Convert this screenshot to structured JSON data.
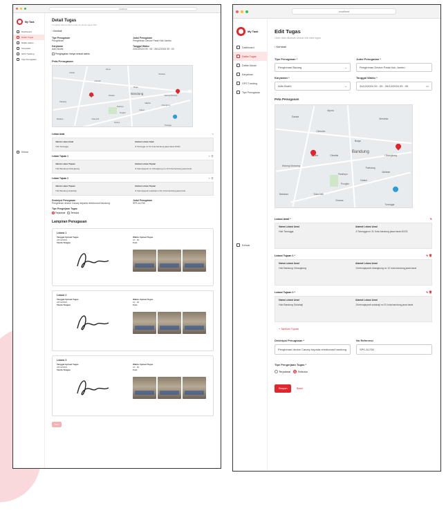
{
  "colors": {
    "brand": "#e0262d",
    "active_bg": "#fde4e5"
  },
  "left": {
    "url": "localhost",
    "brand": "My Task",
    "nav": [
      "Dashboard",
      "Daftar Tugas",
      "Daftar Aduan",
      "Karyawan",
      "GPS Tracking",
      "Tipe Penugasan"
    ],
    "logout": "Keluar",
    "title": "Detail Tugas",
    "subtitle": "Lengkapi data berikut untuk membuat tugas baru",
    "back": "Kembali",
    "fields": {
      "tipe_label": "Tipe Penugasan",
      "tipe_value": "Pengiriman",
      "judul_label": "Judul Penugasan",
      "judul_value": "Pengiriman Device Pada Hub Jambu",
      "karyawan_label": "Karyawan",
      "karyawan_value": "Adhi Budhi",
      "tanggal_label": "Tanggal Waktu",
      "tanggal_value": "24/12/2024 09 : 00 - 26/12/2024 09 : 00",
      "checkbox": "Pengingatan hanya sesuai waktu"
    },
    "map_title": "Peta Penugasan",
    "map_labels": [
      "Gasala",
      "Arjuna",
      "Merdeka",
      "Cimunim",
      "Braga",
      "Bandung",
      "Jamika",
      "Cibadak",
      "Warung Muncang",
      "Paledang",
      "Malabar",
      "Cibangkong",
      "Pasirluyu",
      "Ciateul",
      "Pungkur",
      "Babakan",
      "Suka Asih",
      "Cisarua",
      "Turangga"
    ],
    "lokasi_awal": "Lokasi Awal",
    "lokasi_tujuan1": "Lokasi Tujuan 1",
    "lokasi_tujuan2": "Lokasi Tujuan 2",
    "nama_awal_label": "Nama Lokasi Awal",
    "alamat_awal_label": "Alamat Lokasi Awal",
    "nama_tujuan_label": "Nama Lokasi Tujuan",
    "alamat_tujuan_label": "Alamat Lokasi Tujuan",
    "awal_nama": "Hub Tarungga",
    "awal_alamat": "Jl Tarungga no 31 Kota bandung jawa barat 40231",
    "t1_nama": "Hub Bandung Cibangkong",
    "t1_alamat": "Jl Kebonjayanti no Cibangkong no 12 Kota bandung jawa barat",
    "t2_nama": "Hub Bandung Sukahaji",
    "t2_alamat": "Jl Kebonjayanti sukahaji no 91 Kota bandung jawa barat",
    "desk_label": "Deskripsi Penugasan",
    "desk_value": "Pengiriman device Canary kepada reimbursed bandung",
    "ref_label": "Judul Penugasan",
    "ref_value": "SPK-A1750",
    "tipe_pgj_label": "Tipe Pengerjaan Tugas",
    "tipe_pgj_opt1": "Terjadwal",
    "tipe_pgj_opt2": "Terbuka",
    "lampiran_title": "Lampiran Penugasan",
    "lampiran": [
      {
        "title": "Lokasi 1",
        "tgl_label": "Tanggal Upload Tugas",
        "tgl": "24/12/2024",
        "waktu_label": "Waktu Upload Tugas",
        "waktu": "10 : 00",
        "ttd_label": "Tanda Tangan",
        "foto_label": "Foto"
      },
      {
        "title": "Lokasi 2",
        "tgl_label": "Tanggal Upload Tugas",
        "tgl": "24/12/2024",
        "waktu_label": "Waktu Upload Tugas",
        "waktu": "10 : 00",
        "ttd_label": "Tanda Tangan",
        "foto_label": "Foto"
      },
      {
        "title": "Lokasi 3",
        "tgl_label": "Tanggal Upload Tugas",
        "tgl": "24/12/2024",
        "waktu_label": "Waktu Upload Tugas",
        "waktu": "10 : 00",
        "ttd_label": "Tanda Tangan",
        "foto_label": "Foto"
      }
    ],
    "edit_button": "Edit"
  },
  "right": {
    "url": "localhost",
    "brand": "My Task",
    "nav": [
      "Dashboard",
      "Daftar Tugas",
      "Daftar Aduan",
      "Karyawan",
      "GPS Tracking",
      "Tipe Penugasan"
    ],
    "logout": "Keluar",
    "title": "Edit Tugas",
    "subtitle": "Ubah data dibawah sesuai edit data tugas",
    "back": "Kembali",
    "tipe_label": "Tipe Penugasan *",
    "tipe_value": "Pengiriman Barang",
    "judul_label": "Judul Penugasan *",
    "judul_value": "Pengiriman Device Pada Hub Jambu",
    "karyawan_label": "Karyawan *",
    "karyawan_value": "Adhi Budhi",
    "tanggal_label": "Tanggal Waktu *",
    "tanggal_value": "24/12/2024 09 : 00 - 26/12/2024 09 : 00",
    "map_title": "Peta Penugasan",
    "map_labels": [
      "Gasala",
      "Arjuna",
      "Merdeka",
      "Cimunim",
      "Braga",
      "Bandung",
      "Jamika",
      "Cibadak",
      "Cibangkong",
      "Warung Muncang",
      "Paledang",
      "Malabar",
      "Pasirluyu",
      "Ciateul",
      "Pungkur",
      "Babakan",
      "Suka Asih",
      "Cisarua",
      "Turangga"
    ],
    "lokasi_awal": "Lokasi Awal *",
    "lokasi_tujuan1": "Lokasi Tujuan 1 *",
    "lokasi_tujuan2": "Lokasi Tujuan 2 *",
    "nama_awal_label": "Nama Lokasi Awal",
    "alamat_awal_label": "Alamat Lokasi Awal",
    "nama_tujuan_label": "Nama Lokasi Awal",
    "alamat_tujuan_label": "Alamat Lokasi Awal",
    "awal_nama": "Hub Tarungga",
    "awal_alamat": "Jl Tarungga no 31 Kota bandung jawa barat 40231",
    "t1_nama": "Hub Bandung Cibangkong",
    "t1_alamat": "Jl kebonjayanti cibangkong no 12 kota bandung jawa barat",
    "t2_nama": "Hub Bandung Sukahaji",
    "t2_alamat": "Jl kebonjayanti sukahaji no 91 kota bandung jawa barat",
    "tambah": "+ Tambah Tujuan",
    "desk_label": "Deskripsi Penugasan *",
    "desk_value": "Pengiriman device Canary kepada reimbursed bandung",
    "ref_label": "No Referensi",
    "ref_value": "SPK-A1750",
    "tipe_pgj_label": "Tipe Pengerjaan Tugas *",
    "tipe_pgj_opt1": "Terjadwal",
    "tipe_pgj_opt2": "Terbuka",
    "simpan": "Simpan",
    "batal": "Batal"
  }
}
